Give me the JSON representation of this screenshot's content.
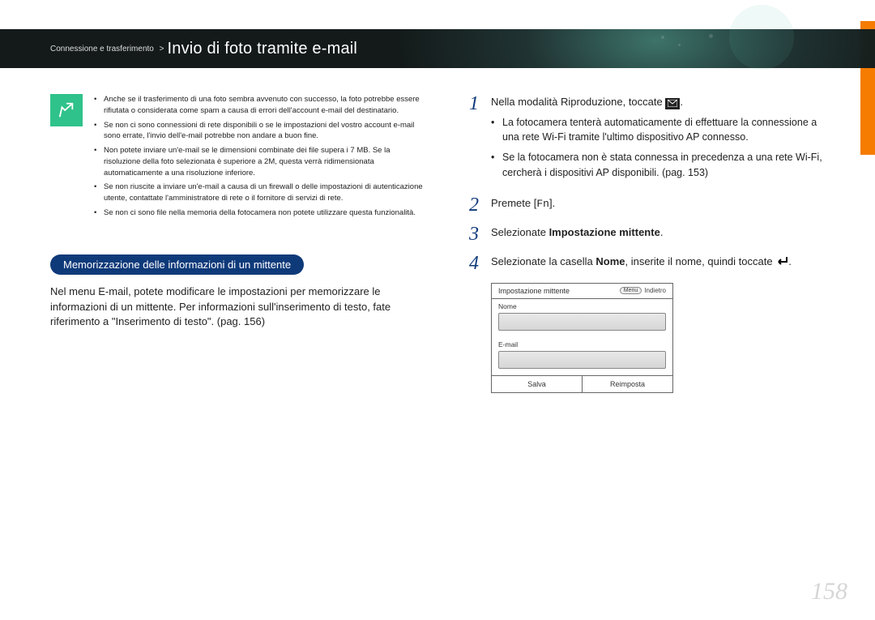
{
  "header": {
    "breadcrumb_section": "Connessione e trasferimento",
    "breadcrumb_sep": ">",
    "title": "Invio di foto tramite e-mail"
  },
  "notes": {
    "items": [
      "Anche se il trasferimento di una foto sembra avvenuto con successo, la foto potrebbe essere rifiutata o considerata come spam a causa di errori dell'account e-mail del destinatario.",
      "Se non ci sono connessioni di rete disponibili o se le impostazioni del vostro account e-mail sono errate, l'invio dell'e-mail potrebbe non andare a buon fine.",
      "Non potete inviare un'e-mail se le dimensioni combinate dei file supera i 7 MB. Se la risoluzione della foto selezionata è superiore a 2M, questa verrà ridimensionata automaticamente a una risoluzione inferiore.",
      "Se non riuscite a inviare un'e-mail a causa di un firewall o delle impostazioni di autenticazione utente, contattate l'amministratore di rete o il fornitore di servizi di rete.",
      "Se non ci sono file nella memoria della fotocamera non potete utilizzare questa funzionalità."
    ]
  },
  "subheading": "Memorizzazione delle informazioni di un mittente",
  "paragraph": "Nel menu E-mail, potete modificare le impostazioni per memorizzare le informazioni di un mittente. Per informazioni sull'inserimento di testo, fate riferimento a \"Inserimento di testo\". (pag. 156)",
  "steps": {
    "s1": {
      "num": "1",
      "text_pre": "Nella modalità Riproduzione, toccate ",
      "text_post": ".",
      "sub": [
        "La fotocamera tenterà automaticamente di effettuare la connessione a una rete Wi-Fi tramite l'ultimo dispositivo AP connesso.",
        "Se la fotocamera non è stata connessa in precedenza a una rete Wi-Fi, cercherà i dispositivi AP disponibili. (pag. 153)"
      ]
    },
    "s2": {
      "num": "2",
      "text_pre": "Premete [",
      "fn": "Fn",
      "text_post": "]."
    },
    "s3": {
      "num": "3",
      "text_pre": "Selezionate ",
      "bold": "Impostazione mittente",
      "text_post": "."
    },
    "s4": {
      "num": "4",
      "text_pre": "Selezionate la casella ",
      "bold": "Nome",
      "text_mid": ", inserite il nome, quindi toccate ",
      "text_post": "."
    }
  },
  "panel": {
    "title": "Impostazione mittente",
    "menu_btn": "Menu",
    "back": "Indietro",
    "label_name": "Nome",
    "label_email": "E-mail",
    "btn_save": "Salva",
    "btn_reset": "Reimposta"
  },
  "page_number": "158"
}
